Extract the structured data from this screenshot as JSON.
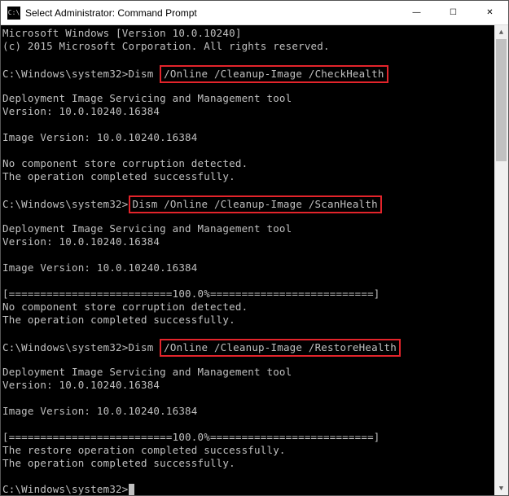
{
  "titlebar": {
    "icon_text": "C:\\",
    "title": "Select Administrator: Command Prompt",
    "minimize": "—",
    "maximize": "☐",
    "close": "✕"
  },
  "terminal": {
    "header1": "Microsoft Windows [Version 10.0.10240]",
    "header2": "(c) 2015 Microsoft Corporation. All rights reserved.",
    "prompt1_pre": "C:\\Windows\\system32>Dism ",
    "prompt1_hl": "/Online /Cleanup-Image /CheckHealth",
    "tool_line": "Deployment Image Servicing and Management tool",
    "ver_line": "Version: 10.0.10240.16384",
    "img_ver_line": "Image Version: 10.0.10240.16384",
    "no_corrupt": "No component store corruption detected.",
    "op_success": "The operation completed successfully.",
    "prompt2_pre": "C:\\Windows\\system32>",
    "prompt2_hl": "Dism /Online /Cleanup-Image /ScanHealth",
    "progress": "[==========================100.0%==========================]",
    "prompt3_pre": "C:\\Windows\\system32>Dism ",
    "prompt3_hl": "/Online /Cleanup-Image /RestoreHealth",
    "restore_success": "The restore operation completed successfully.",
    "prompt_final": "C:\\Windows\\system32>"
  }
}
